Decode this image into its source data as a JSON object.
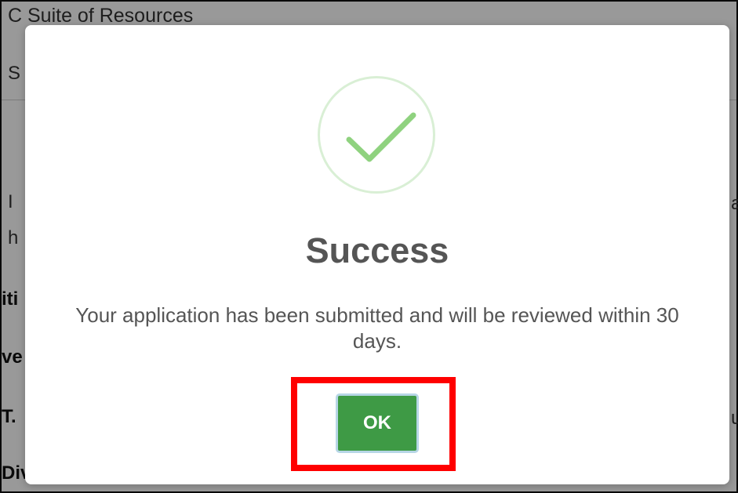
{
  "background_page": {
    "title": "C Suite of Resources",
    "fragments": [
      "S",
      "I",
      "h",
      "iti",
      "ve",
      "T.",
      "Div",
      "a",
      "u"
    ]
  },
  "modal": {
    "title": "Success",
    "message": "Your application has been submitted and will be reviewed within 30 days.",
    "icon": "checkmark-icon",
    "ok_label": "OK"
  },
  "colors": {
    "success_icon": "#8fd27f",
    "button_bg": "#3e9a45",
    "highlight": "#ff0000"
  }
}
